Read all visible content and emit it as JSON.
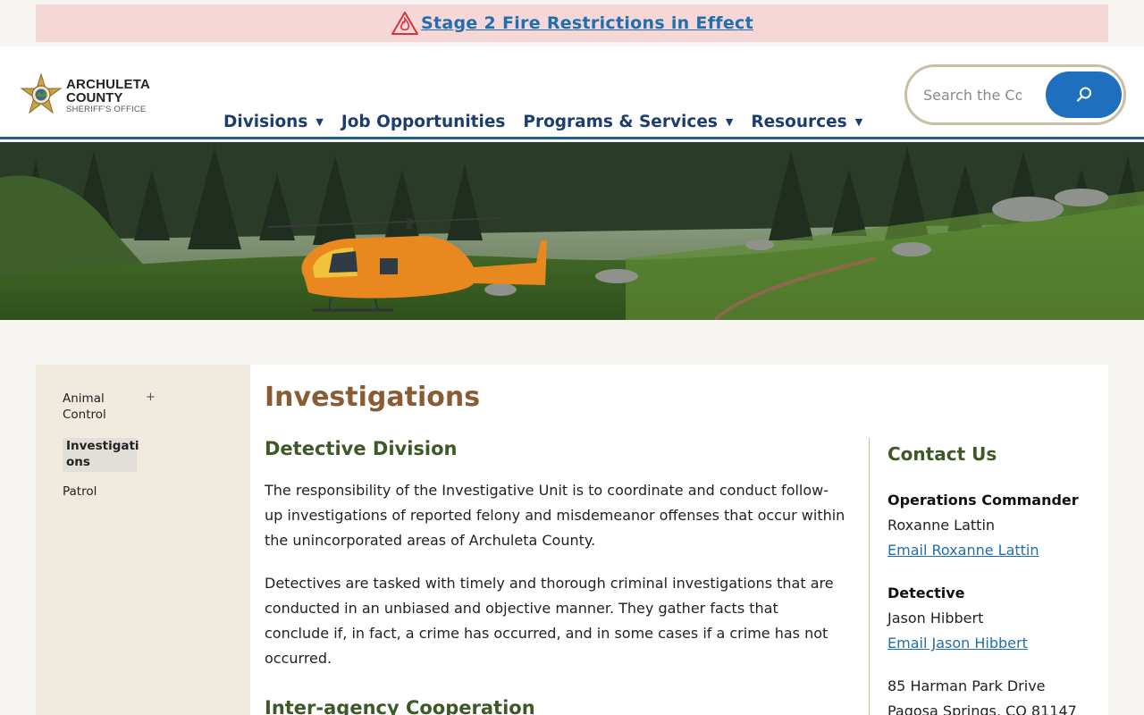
{
  "alert": {
    "text": "Stage 2 Fire Restrictions in Effect"
  },
  "logo": {
    "line1": "ARCHULETA",
    "line2": "COUNTY",
    "line3": "SHERIFF'S OFFICE"
  },
  "nav": {
    "items": [
      {
        "label": "Divisions",
        "has_dropdown": true
      },
      {
        "label": "Job Opportunities",
        "has_dropdown": false
      },
      {
        "label": "Programs & Services",
        "has_dropdown": true
      },
      {
        "label": "Resources",
        "has_dropdown": true
      }
    ]
  },
  "search": {
    "placeholder": "Search the County"
  },
  "sidebar": {
    "items": [
      {
        "label": "Animal Control"
      },
      {
        "label": "Investigations",
        "active": true
      },
      {
        "label": "Patrol"
      }
    ],
    "expand_glyph": "+"
  },
  "main": {
    "title": "Investigations",
    "section1": {
      "heading": "Detective Division",
      "p1": "The responsibility of the Investigative Unit is to coordinate and conduct follow-up investigations of reported felony and misdemeanor offenses that occur within the unincorporated areas of Archuleta County.",
      "p2": "Detectives are tasked with timely and thorough criminal investigations that are conducted in an unbiased and objective manner. They gather facts that conclude if, in fact, a crime has occurred, and in some cases if a crime has not occurred."
    },
    "section2": {
      "heading": "Inter-agency Cooperation"
    }
  },
  "contact": {
    "title": "Contact Us",
    "people": [
      {
        "role": "Operations Commander",
        "name": "Roxanne Lattin",
        "email_label": "Email Roxanne Lattin"
      },
      {
        "role": "Detective",
        "name": "Jason Hibbert",
        "email_label": "Email Jason Hibbert"
      }
    ],
    "address_line1": "85 Harman Park Drive",
    "address_line2": "Pagosa Springs, CO 81147"
  },
  "colors": {
    "nav_text": "#1c3e6e",
    "search_button": "#1f6fbf",
    "title_brown": "#8a5c34",
    "heading_green": "#3d5a26",
    "link_blue": "#1f6fae",
    "alert_bg": "#f6d7d8"
  },
  "icons": {
    "alert": "fire-warning-icon",
    "search": "search-icon",
    "logo": "sheriff-star-badge-icon",
    "dropdown": "caret-down-icon"
  }
}
